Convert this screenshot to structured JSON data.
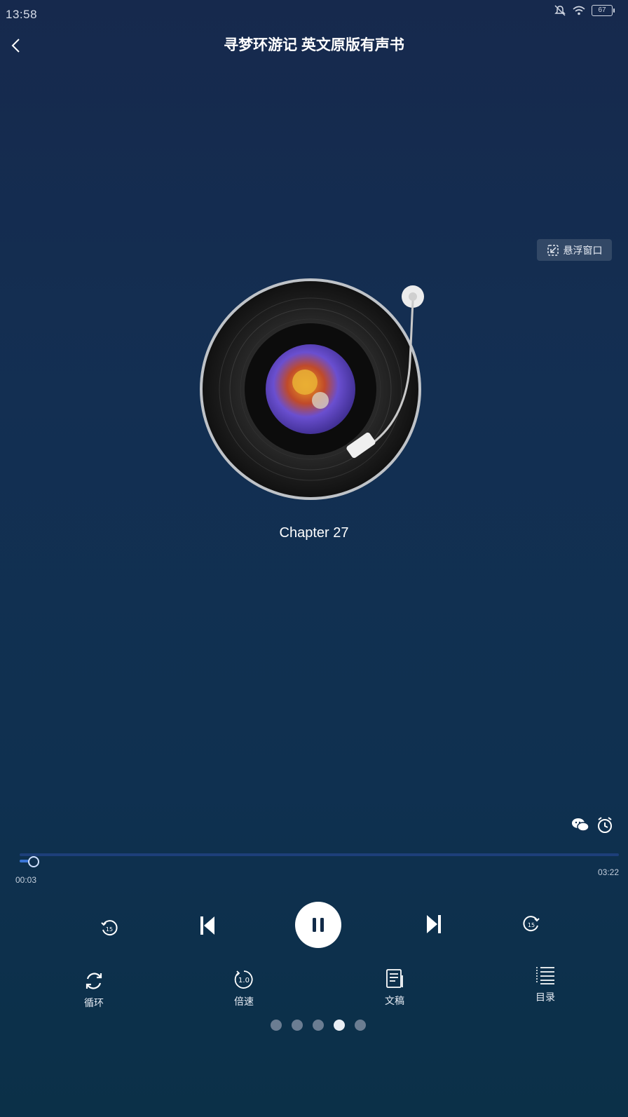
{
  "status_bar": {
    "time": "13:58",
    "battery": "67"
  },
  "header": {
    "title": "寻梦环游记 英文原版有声书"
  },
  "float_window": {
    "label": "悬浮窗口"
  },
  "player": {
    "chapter": "Chapter 27",
    "current_time": "00:03",
    "total_time": "03:22",
    "progress": 0.015,
    "rewind_seconds": "15",
    "forward_seconds": "15",
    "state": "playing"
  },
  "functions": {
    "loop_label": "循环",
    "speed_label": "倍速",
    "speed_value": "1.0",
    "transcript_label": "文稿",
    "catalog_label": "目录"
  },
  "pager": {
    "count": 5,
    "active_index": 3
  }
}
